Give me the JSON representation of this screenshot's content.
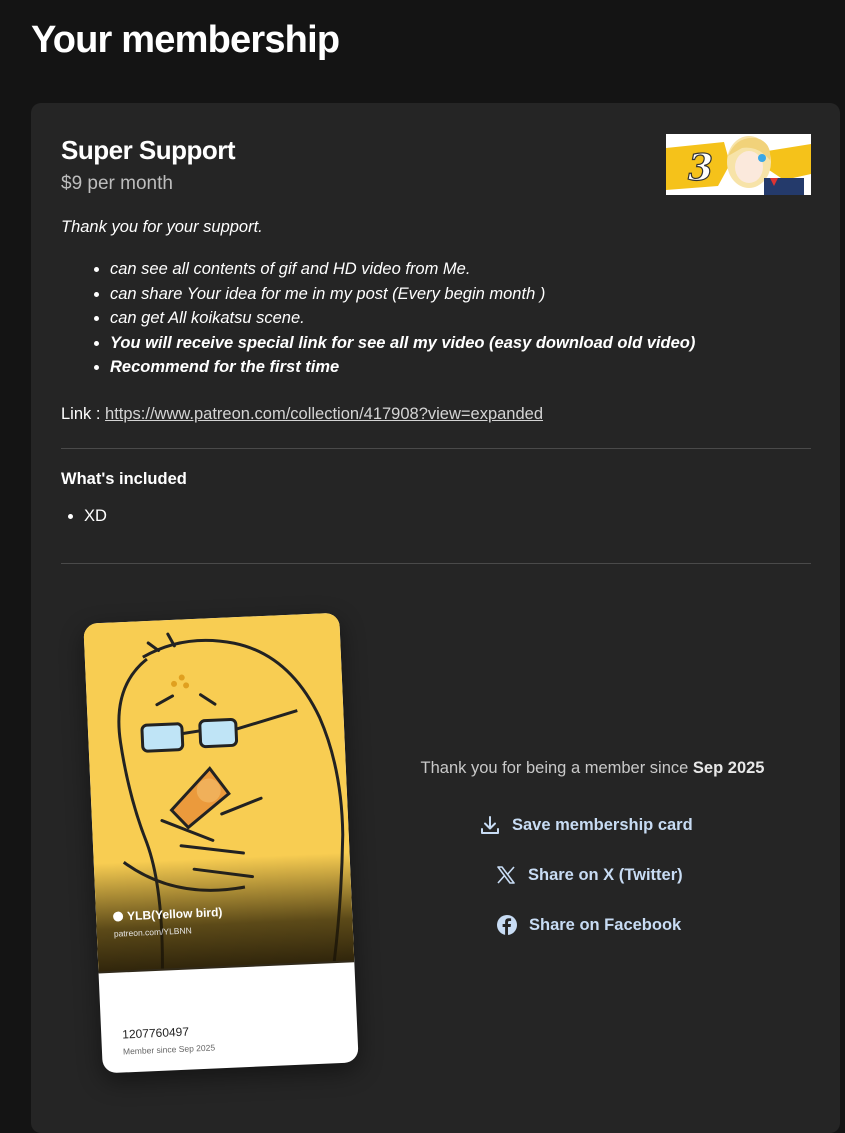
{
  "page": {
    "title": "Your membership"
  },
  "tier": {
    "name": "Super Support",
    "price": "$9 per month",
    "thanks": "Thank you for your support.",
    "benefits": [
      {
        "text": "can see all contents of gif and HD video from Me.",
        "bold": false
      },
      {
        "text": "can share Your idea for me in my post (Every begin month )",
        "bold": false
      },
      {
        "text": "can get All koikatsu scene.",
        "bold": false
      },
      {
        "text": "You will receive special link for see all my video (easy download old video)",
        "bold": true
      },
      {
        "text": "Recommend for the first time",
        "bold": true
      }
    ],
    "link_label": "Link :",
    "link_url": "https://www.patreon.com/collection/417908?view=expanded",
    "thumbnail_number": "3"
  },
  "included": {
    "heading": "What's included",
    "items": [
      "XD"
    ]
  },
  "membership_card": {
    "creator_name": "YLB(Yellow bird)",
    "creator_url": "patreon.com/YLBNN",
    "member_id": "1207760497",
    "member_since": "Member since Sep 2025",
    "card_color": "#f8cd52"
  },
  "share": {
    "thanks_prefix": "Thank you for being a member since",
    "thanks_date": "Sep 2025",
    "actions": [
      {
        "label": "Save membership card",
        "icon": "download-icon"
      },
      {
        "label": "Share on X (Twitter)",
        "icon": "x-logo-icon"
      },
      {
        "label": "Share on Facebook",
        "icon": "facebook-icon"
      }
    ],
    "action_color": "#c8dcf4"
  }
}
